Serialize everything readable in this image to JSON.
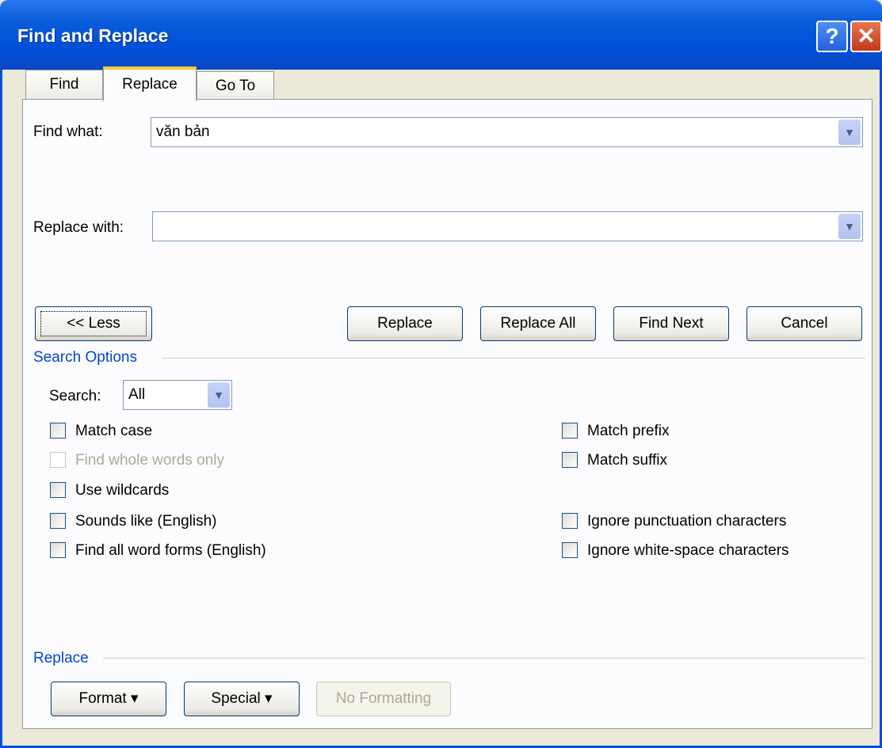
{
  "window": {
    "title": "Find and Replace",
    "help_glyph": "?",
    "close_glyph": "✕"
  },
  "tabs": [
    {
      "label": "Find",
      "active": false
    },
    {
      "label": "Replace",
      "active": true
    },
    {
      "label": "Go To",
      "active": false
    }
  ],
  "find": {
    "label": "Find what:",
    "value": "văn bản"
  },
  "replace_with": {
    "label": "Replace with:",
    "value": ""
  },
  "buttons": {
    "less": "<< Less",
    "replace": "Replace",
    "replace_all": "Replace All",
    "find_next": "Find Next",
    "cancel": "Cancel"
  },
  "search_options": {
    "heading": "Search Options",
    "search_label": "Search:",
    "search_value": "All",
    "checkboxes_left": [
      {
        "label": "Match case",
        "checked": false,
        "disabled": false
      },
      {
        "label": "Find whole words only",
        "checked": false,
        "disabled": true
      },
      {
        "label": "Use wildcards",
        "checked": false,
        "disabled": false
      },
      {
        "label": "Sounds like (English)",
        "checked": false,
        "disabled": false
      },
      {
        "label": "Find all word forms (English)",
        "checked": false,
        "disabled": false
      }
    ],
    "checkboxes_right": [
      {
        "label": "Match prefix",
        "checked": false,
        "disabled": false
      },
      {
        "label": "Match suffix",
        "checked": false,
        "disabled": false
      },
      {
        "label": "Ignore punctuation characters",
        "checked": false,
        "disabled": false
      },
      {
        "label": "Ignore white-space characters",
        "checked": false,
        "disabled": false
      }
    ]
  },
  "replace_section": {
    "heading": "Replace",
    "format": "Format ▾",
    "special": "Special ▾",
    "no_formatting": "No Formatting"
  },
  "icons": {
    "dropdown_arrow": "chevron-down-icon"
  },
  "colors": {
    "titlebar": "#0050d8",
    "section_heading": "#0046d5",
    "tab_highlight": "#ffc83c"
  }
}
